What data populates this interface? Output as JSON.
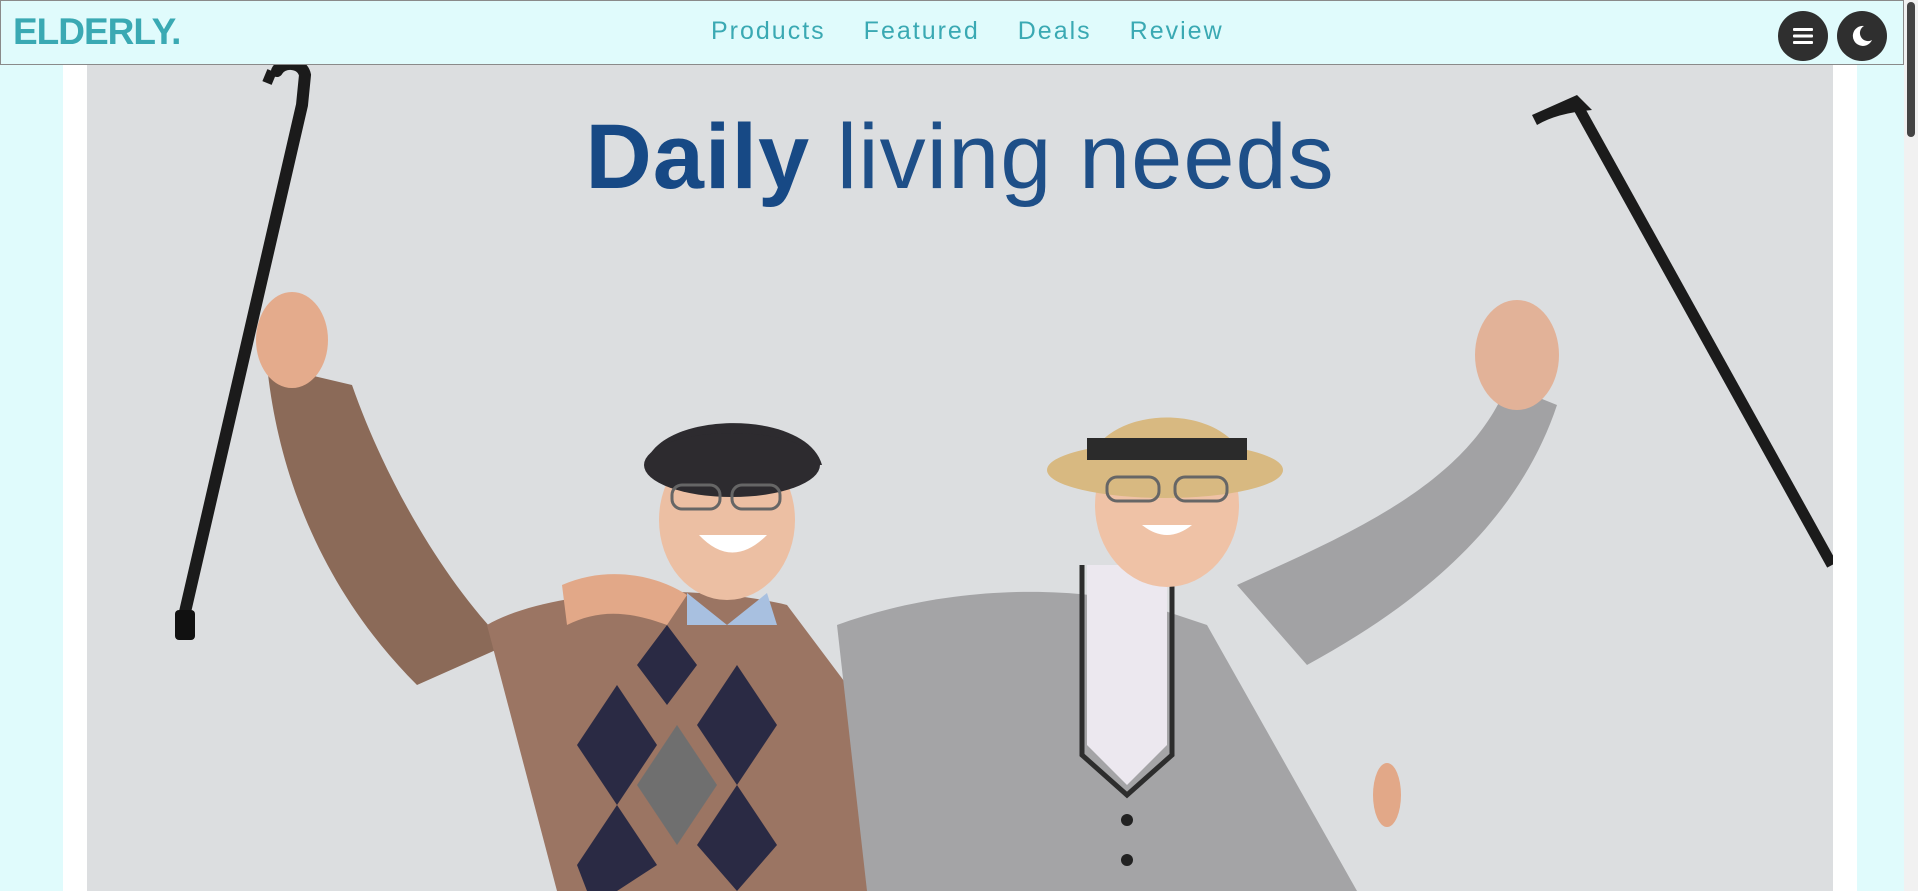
{
  "header": {
    "logo": "ELDERLY.",
    "nav": [
      "Products",
      "Featured",
      "Deals",
      "Review"
    ],
    "menu_icon": "hamburger-menu-icon",
    "theme_icon": "moon-icon"
  },
  "banner": {
    "title_bold": "Daily",
    "title_light": " living needs"
  },
  "colors": {
    "background": "#e0fbfc",
    "accent": "#3aa9b3",
    "title": "#174985",
    "button": "#2f2f2f"
  }
}
